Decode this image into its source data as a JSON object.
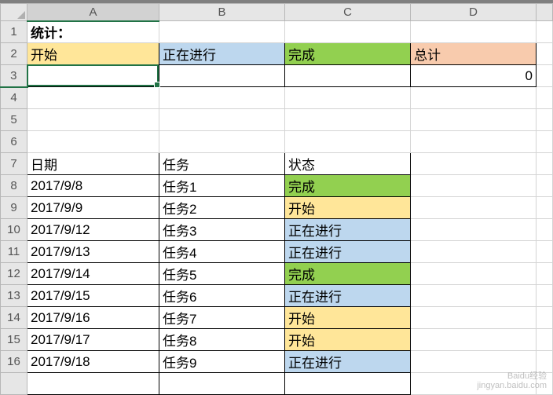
{
  "columns": [
    "A",
    "B",
    "C",
    "D"
  ],
  "rows": [
    "1",
    "2",
    "3",
    "4",
    "5",
    "6",
    "7",
    "8",
    "9",
    "10",
    "11",
    "12",
    "13",
    "14",
    "15",
    "16",
    ""
  ],
  "active": {
    "col": "A",
    "row": "3"
  },
  "chart_data": {
    "type": "table",
    "title": "统计：",
    "summary": {
      "headers": [
        "开始",
        "正在进行",
        "完成",
        "总计"
      ],
      "values": [
        "",
        "",
        "",
        "0"
      ]
    },
    "data_table": {
      "headers": [
        "日期",
        "任务",
        "状态"
      ],
      "rows": [
        {
          "date": "2017/9/8",
          "task": "任务1",
          "status": "完成",
          "fill": "green"
        },
        {
          "date": "2017/9/9",
          "task": "任务2",
          "status": "开始",
          "fill": "yellow"
        },
        {
          "date": "2017/9/12",
          "task": "任务3",
          "status": "正在进行",
          "fill": "blue"
        },
        {
          "date": "2017/9/13",
          "task": "任务4",
          "status": "正在进行",
          "fill": "blue"
        },
        {
          "date": "2017/9/14",
          "task": "任务5",
          "status": "完成",
          "fill": "green"
        },
        {
          "date": "2017/9/15",
          "task": "任务6",
          "status": "正在进行",
          "fill": "blue"
        },
        {
          "date": "2017/9/16",
          "task": "任务7",
          "status": "开始",
          "fill": "yellow"
        },
        {
          "date": "2017/9/17",
          "task": "任务8",
          "status": "开始",
          "fill": "yellow"
        },
        {
          "date": "2017/9/18",
          "task": "任务9",
          "status": "正在进行",
          "fill": "blue"
        }
      ]
    }
  },
  "watermark": {
    "l1": "Baidu经验",
    "l2": "jingyan.baidu.com"
  }
}
